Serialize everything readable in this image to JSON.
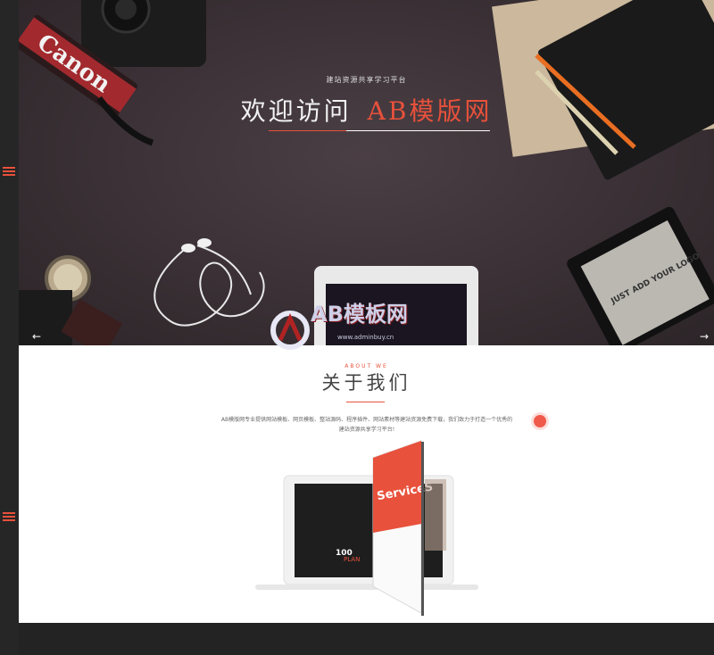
{
  "hero": {
    "subtitle": "建站资源共享学习平台",
    "title_white": "欢迎访问",
    "title_red": "AB模版网",
    "camera_brand": "Canon",
    "tablet_text": "JUST ADD YOUR LOGO",
    "prev_arrow": "←",
    "next_arrow": "→"
  },
  "about": {
    "label_en": "ABOUT WE",
    "title": "关于我们",
    "description": "AB模版网专业提供网站模板、网页模板、整站源码、程序插件、网站素材等建站资源免费下载，我们致力于打造一个优秀的建站资源共享学习平台!",
    "mock_heading": "ServiceS",
    "mock_number": "100",
    "mock_subtext": "PLAN"
  },
  "watermark": {
    "text": "AB模板网",
    "url": "www.adminbuy.cn"
  },
  "colors": {
    "accent": "#e8513b",
    "sidebar": "#262626",
    "footer": "#232323"
  },
  "icons": {
    "menu": "hamburger-menu-icon",
    "prev": "arrow-left-icon",
    "next": "arrow-right-icon"
  }
}
